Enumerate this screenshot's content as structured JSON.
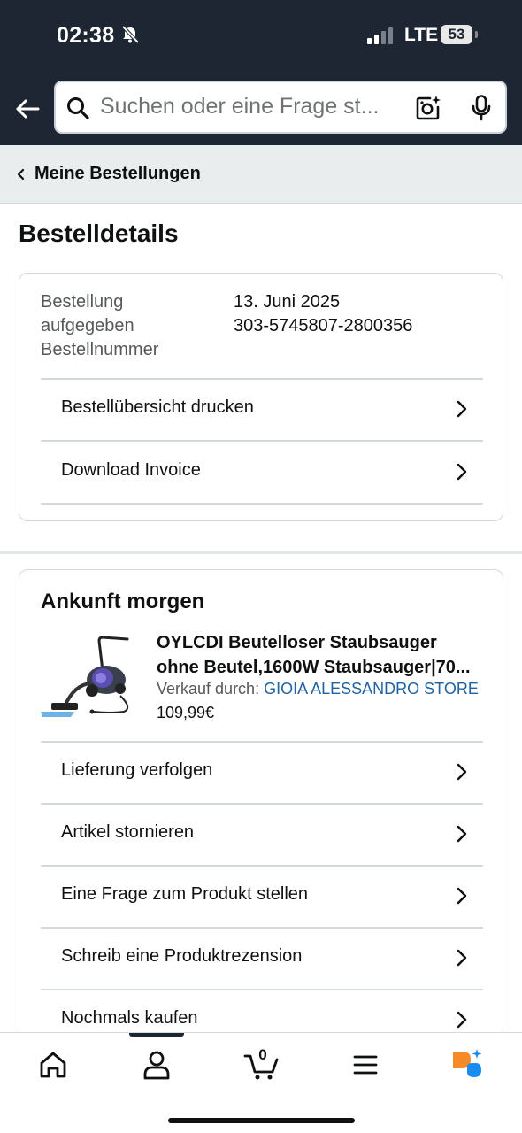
{
  "status_bar": {
    "time": "02:38",
    "network": "LTE",
    "battery": "53"
  },
  "search": {
    "placeholder": "Suchen oder eine Frage st..."
  },
  "breadcrumb": {
    "label": "Meine Bestellungen"
  },
  "page": {
    "title": "Bestelldetails"
  },
  "order_info": {
    "label_line1": "Bestellung",
    "label_line2": "aufgegeben",
    "label_line3": "Bestellnummer",
    "date": "13. Juni 2025",
    "number": "303-5745807-2800356"
  },
  "order_actions": [
    {
      "label": "Bestellübersicht drucken"
    },
    {
      "label": "Download Invoice"
    }
  ],
  "shipment": {
    "heading": "Ankunft morgen",
    "product_title_line1": "OYLCDI Beutelloser Staubsauger",
    "product_title_line2": "ohne Beutel,1600W Staubsauger|70...",
    "seller_prefix": "Verkauf durch:",
    "seller_name": "GIOIA ALESSANDRO STORE",
    "price": "109,99€",
    "actions": [
      {
        "label": "Lieferung verfolgen"
      },
      {
        "label": "Artikel stornieren"
      },
      {
        "label": "Eine Frage zum Produkt stellen"
      },
      {
        "label": "Schreib eine Produktrezension"
      },
      {
        "label": "Nochmals kaufen"
      }
    ]
  },
  "tab_bar": {
    "cart_count": "0",
    "active_tab": "account"
  }
}
